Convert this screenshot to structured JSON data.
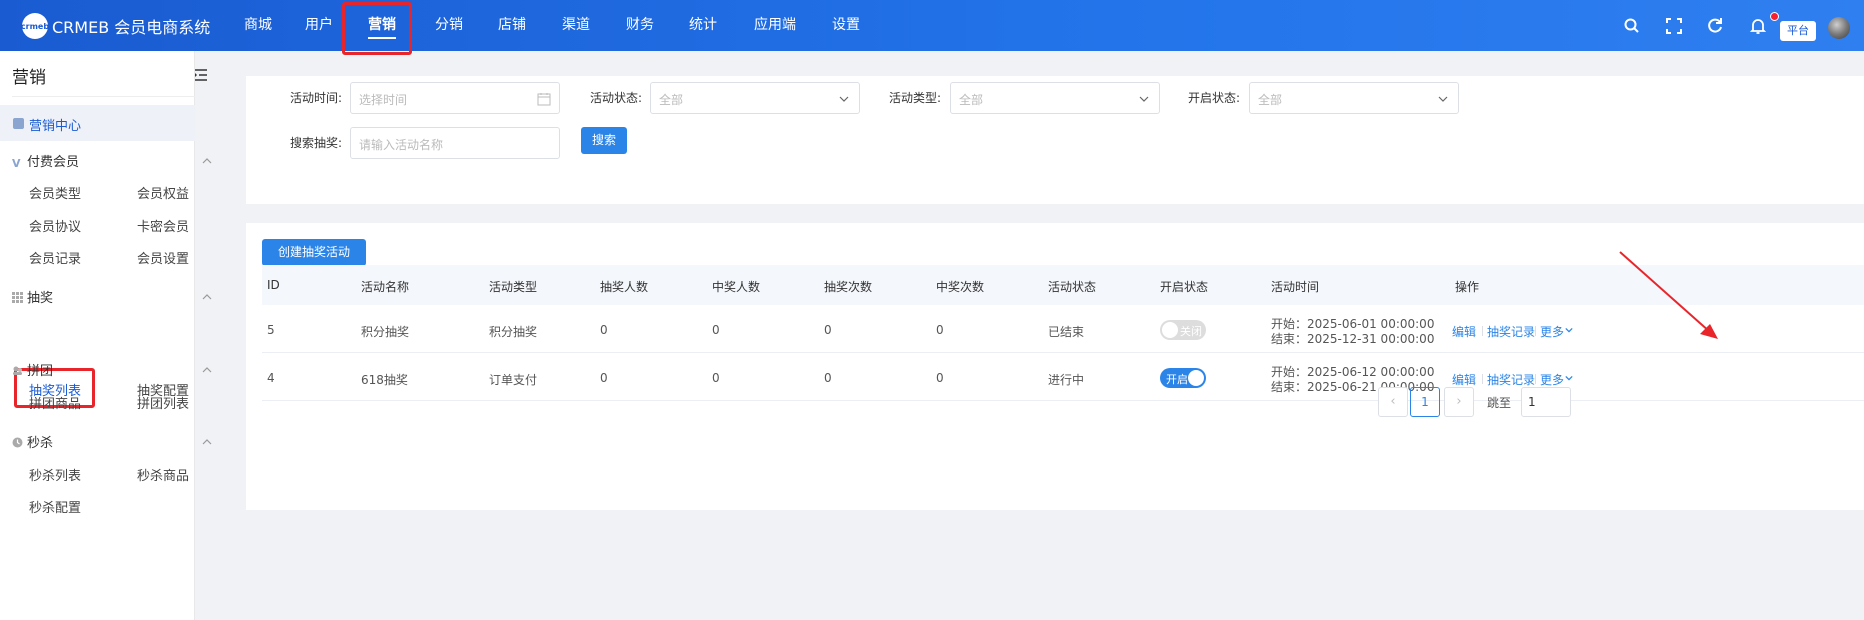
{
  "header": {
    "logo_mark": "crmeb",
    "logo_text": "CRMEB 会员电商系统",
    "nav": [
      "商城",
      "用户",
      "营销",
      "分销",
      "店铺",
      "渠道",
      "财务",
      "统计",
      "应用端",
      "设置"
    ],
    "active_nav": "营销",
    "icons": [
      "search-icon",
      "fullscreen-icon",
      "refresh-icon",
      "bell-icon"
    ],
    "platform_label": "平台"
  },
  "sidebar": {
    "title": "营销",
    "center_label": "营销中心",
    "groups": [
      {
        "label": "付费会员",
        "icon": "vip-icon",
        "items": [
          "会员类型",
          "会员权益",
          "会员协议",
          "卡密会员",
          "会员记录",
          "会员设置"
        ]
      },
      {
        "label": "抽奖",
        "icon": "grid-icon",
        "items": [
          "抽奖列表",
          "抽奖配置"
        ]
      },
      {
        "label": "拼团",
        "icon": "group-icon",
        "items": [
          "拼团商品",
          "拼团列表"
        ]
      },
      {
        "label": "秒杀",
        "icon": "clock-icon",
        "items": [
          "秒杀列表",
          "秒杀商品",
          "秒杀配置"
        ]
      }
    ],
    "active_item": "抽奖列表"
  },
  "filters": {
    "time_label": "活动时间:",
    "time_placeholder": "选择时间",
    "status_label": "活动状态:",
    "status_value": "全部",
    "type_label": "活动类型:",
    "type_value": "全部",
    "open_label": "开启状态:",
    "open_value": "全部",
    "search_label": "搜索抽奖:",
    "search_placeholder": "请输入活动名称",
    "search_button": "搜索"
  },
  "table": {
    "create_button": "创建抽奖活动",
    "columns": [
      "ID",
      "活动名称",
      "活动类型",
      "抽奖人数",
      "中奖人数",
      "抽奖次数",
      "中奖次数",
      "活动状态",
      "开启状态",
      "活动时间",
      "操作"
    ],
    "rows": [
      {
        "id": "5",
        "name": "积分抽奖",
        "type": "积分抽奖",
        "draw_users": "0",
        "win_users": "0",
        "draw_times": "0",
        "win_times": "0",
        "status": "已结束",
        "switch_label": "关闭",
        "switch_on": false,
        "start": "开始：2025-06-01 00:00:00",
        "end": "结束：2025-12-31 00:00:00"
      },
      {
        "id": "4",
        "name": "618抽奖",
        "type": "订单支付",
        "draw_users": "0",
        "win_users": "0",
        "draw_times": "0",
        "win_times": "0",
        "status": "进行中",
        "switch_label": "开启",
        "switch_on": true,
        "start": "开始：2025-06-12 00:00:00",
        "end": "结束：2025-06-21 00:00:00"
      }
    ],
    "actions": {
      "edit": "编辑",
      "records": "抽奖记录",
      "more": "更多"
    }
  },
  "pagination": {
    "current_page": "1",
    "jump_label": "跳至",
    "jump_value": "1"
  },
  "colors": {
    "primary": "#2b85e8",
    "header": "#1a5bd1",
    "highlight_box": "#e8252b"
  }
}
